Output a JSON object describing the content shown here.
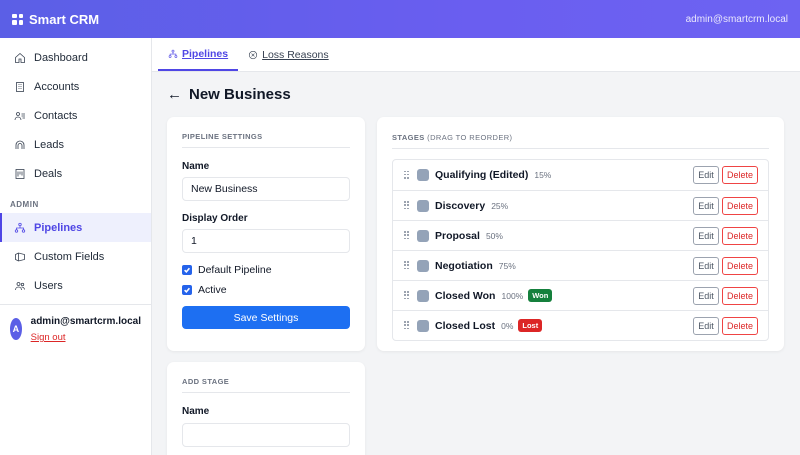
{
  "app": {
    "name": "Smart CRM",
    "header_user": "admin@smartcrm.local"
  },
  "sidebar": {
    "items": [
      {
        "label": "Dashboard",
        "icon": "home-icon"
      },
      {
        "label": "Accounts",
        "icon": "building-icon"
      },
      {
        "label": "Contacts",
        "icon": "contacts-icon"
      },
      {
        "label": "Leads",
        "icon": "leads-icon"
      },
      {
        "label": "Deals",
        "icon": "deals-icon"
      }
    ],
    "admin_section": "ADMIN",
    "admin_items": [
      {
        "label": "Pipelines",
        "icon": "pipeline-icon",
        "active": true
      },
      {
        "label": "Custom Fields",
        "icon": "fields-icon"
      },
      {
        "label": "Users",
        "icon": "users-icon"
      }
    ],
    "user": {
      "avatar_letter": "A",
      "email": "admin@smartcrm.local",
      "signout": "Sign out"
    }
  },
  "tabs": [
    {
      "label": "Pipelines",
      "active": true,
      "icon": "pipeline-icon"
    },
    {
      "label": "Loss Reasons",
      "active": false,
      "icon": "x-circle-icon"
    }
  ],
  "page": {
    "back": "←",
    "title": "New Business"
  },
  "settings": {
    "section_title": "PIPELINE SETTINGS",
    "name_label": "Name",
    "name_value": "New Business",
    "order_label": "Display Order",
    "order_value": "1",
    "default_label": "Default Pipeline",
    "default_checked": true,
    "active_label": "Active",
    "active_checked": true,
    "save_label": "Save Settings"
  },
  "add_stage": {
    "section_title": "ADD STAGE",
    "name_label": "Name",
    "name_value": ""
  },
  "stages": {
    "section_title": "STAGES",
    "section_hint": "(DRAG TO REORDER)",
    "edit_label": "Edit",
    "delete_label": "Delete",
    "swatch_color": "#94a3b8",
    "rows": [
      {
        "name": "Qualifying (Edited)",
        "pct": "15%",
        "badge": ""
      },
      {
        "name": "Discovery",
        "pct": "25%",
        "badge": ""
      },
      {
        "name": "Proposal",
        "pct": "50%",
        "badge": ""
      },
      {
        "name": "Negotiation",
        "pct": "75%",
        "badge": ""
      },
      {
        "name": "Closed Won",
        "pct": "100%",
        "badge": "Won",
        "badge_type": "won"
      },
      {
        "name": "Closed Lost",
        "pct": "0%",
        "badge": "Lost",
        "badge_type": "lost"
      }
    ]
  },
  "colors": {
    "accent": "#5b5fe6",
    "primary_button": "#1d6ff2",
    "won": "#15803d",
    "lost": "#dc2626"
  }
}
